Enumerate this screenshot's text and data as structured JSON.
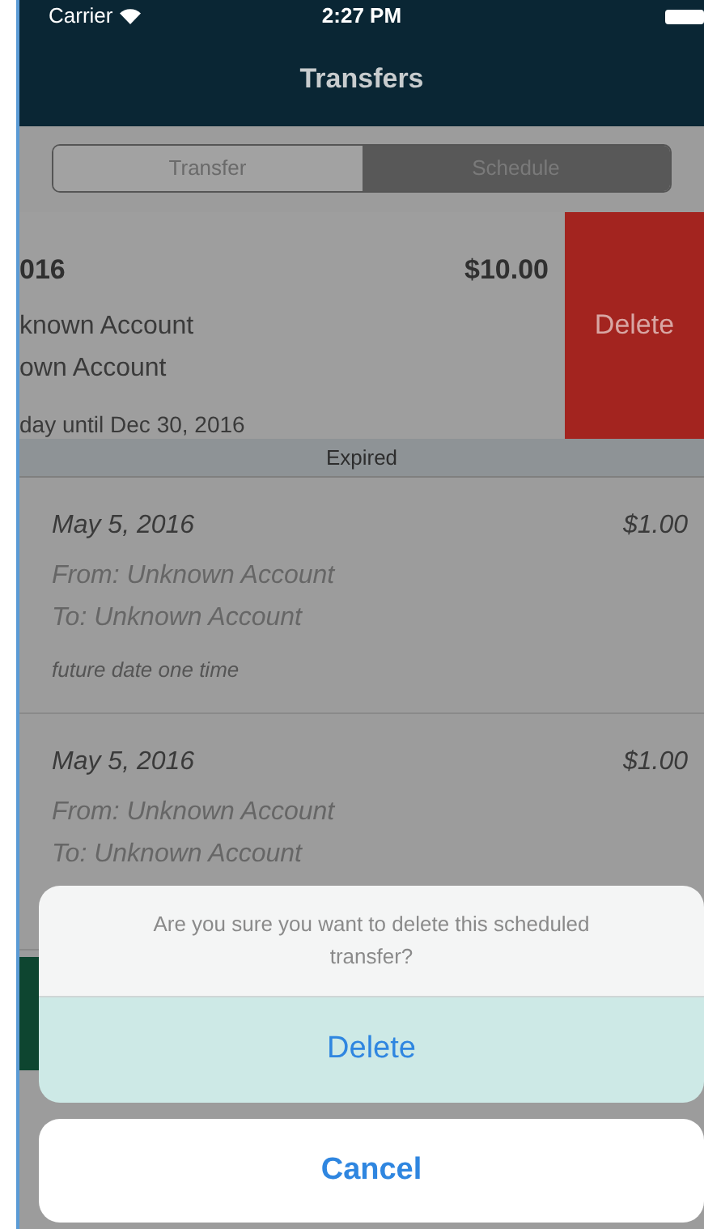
{
  "status_bar": {
    "carrier": "Carrier",
    "time": "2:27 PM"
  },
  "nav": {
    "title": "Transfers"
  },
  "segments": [
    {
      "label": "Transfer",
      "selected": false
    },
    {
      "label": "Schedule",
      "selected": true
    }
  ],
  "swiped_row": {
    "date": "016",
    "amount": "$10.00",
    "from": "known Account",
    "to": "own Account",
    "note": "day until Dec 30, 2016",
    "action": "Delete"
  },
  "section_header": "Expired",
  "rows": [
    {
      "date": "May 5, 2016",
      "amount": "$1.00",
      "from": "From: Unknown Account",
      "to": "To: Unknown Account",
      "note": "future date one time"
    },
    {
      "date": "May 5, 2016",
      "amount": "$1.00",
      "from": "From: Unknown Account",
      "to": "To: Unknown Account"
    }
  ],
  "action_sheet": {
    "message": "Are you sure you want to delete this scheduled transfer?",
    "actions": [
      "Delete"
    ],
    "cancel": "Cancel"
  }
}
